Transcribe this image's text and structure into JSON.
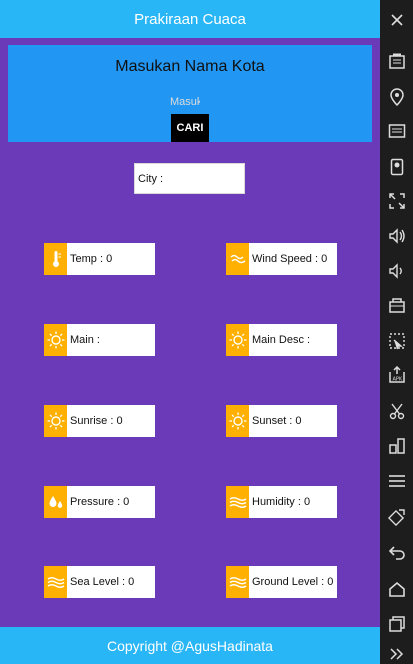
{
  "app": {
    "title": "Prakiraan Cuaca",
    "footer": "Copyright @AgusHadinata"
  },
  "search": {
    "title": "Masukan Nama Kota",
    "placeholder": "Masukan Nama Kota",
    "button_label": "CARI"
  },
  "city": {
    "label": "City :"
  },
  "cards": {
    "temp": {
      "label": "Temp : 0",
      "icon": "thermometer-icon"
    },
    "wind_speed": {
      "label": "Wind Speed : 0",
      "icon": "wind-icon"
    },
    "main": {
      "label": "Main :",
      "icon": "sun-icon"
    },
    "main_desc": {
      "label": "Main Desc :",
      "icon": "sun-icon"
    },
    "sunrise": {
      "label": "Sunrise : 0",
      "icon": "sun-icon"
    },
    "sunset": {
      "label": "Sunset : 0",
      "icon": "sun-icon"
    },
    "pressure": {
      "label": "Pressure : 0",
      "icon": "drops-icon"
    },
    "humidity": {
      "label": "Humidity : 0",
      "icon": "waves-icon"
    },
    "sea_level": {
      "label": "Sea Level : 0",
      "icon": "waves-icon"
    },
    "ground_level": {
      "label": "Ground Level : 0",
      "icon": "waves-icon"
    }
  },
  "colors": {
    "background": "#6a3ab8",
    "appbar": "#29b6f6",
    "search_panel": "#2196f3",
    "icon_tile": "#ffb000",
    "toolbar": "#1d1d1d"
  },
  "emulator_toolbar": {
    "buttons": [
      "close-icon",
      "battery-icon",
      "location-icon",
      "cast-icon",
      "camera-icon",
      "fullscreen-icon",
      "volume-up-icon",
      "volume-down-icon",
      "identify-icon",
      "pixel-perfect-icon",
      "apk-install-icon",
      "cut-icon",
      "apps-icon",
      "menu-icon",
      "rotate-icon",
      "back-icon",
      "home-icon",
      "recents-icon",
      "more-icon"
    ]
  }
}
